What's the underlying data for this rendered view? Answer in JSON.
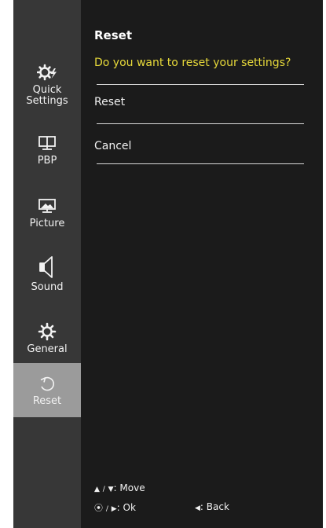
{
  "sidebar": {
    "items": [
      {
        "label": "Quick\nSettings",
        "icon": "quick-settings-icon"
      },
      {
        "label": "PBP",
        "icon": "pbp-icon"
      },
      {
        "label": "Picture",
        "icon": "picture-icon"
      },
      {
        "label": "Sound",
        "icon": "sound-icon"
      },
      {
        "label": "General",
        "icon": "general-icon"
      },
      {
        "label": "Reset",
        "icon": "reset-icon",
        "active": true
      }
    ]
  },
  "main": {
    "title": "Reset",
    "question": "Do you want to reset your settings?",
    "options": [
      {
        "label": "Reset"
      },
      {
        "label": "Cancel"
      }
    ]
  },
  "help": {
    "move_label": "Move",
    "move_sep": "/",
    "ok_label": "Ok",
    "ok_sep": "/",
    "back_label": "Back"
  },
  "colors": {
    "accent_question": "#e7d93a",
    "sidebar_bg": "#373737",
    "active_bg": "#9b9b9b",
    "panel_bg": "#1b1b1b"
  }
}
